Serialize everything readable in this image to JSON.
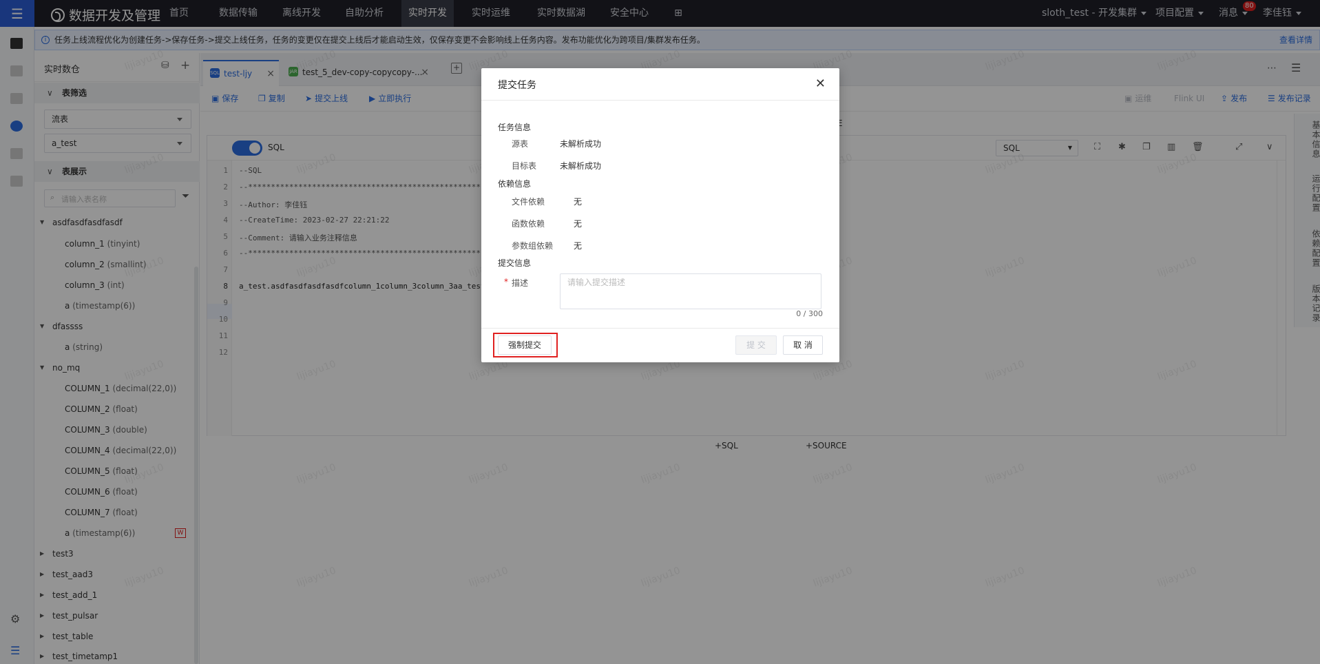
{
  "topnav": {
    "app_title": "数据开发及管理",
    "items": [
      "首页",
      "数据传输",
      "离线开发",
      "自助分析",
      "实时开发",
      "实时运维",
      "实时数据湖",
      "安全中心"
    ],
    "active": "实时开发",
    "cluster": "sloth_test - 开发集群",
    "project_config": "项目配置",
    "messages": "消息",
    "message_count": "80",
    "user": "李佳钰"
  },
  "notice": {
    "text": "任务上线流程优化为创建任务->保存任务->提交上线任务，任务的变更仅在提交上线后才能启动生效，仅保存变更不会影响线上任务内容。发布功能优化为跨项目/集群发布任务。",
    "link": "查看详情"
  },
  "left_panel": {
    "title": "实时数仓",
    "filter_section": "表筛选",
    "stream_select": "流表",
    "db_select": "a_test",
    "display_section": "表展示",
    "search_placeholder": "请输入表名称",
    "tree": [
      {
        "name": "asdfasdfasdfasdf",
        "expanded": true,
        "columns": [
          {
            "name": "column_1",
            "type": "(tinyint)"
          },
          {
            "name": "column_2",
            "type": "(smallint)"
          },
          {
            "name": "column_3",
            "type": "(int)"
          },
          {
            "name": "a",
            "type": "(timestamp(6))"
          }
        ]
      },
      {
        "name": "dfassss",
        "expanded": true,
        "columns": [
          {
            "name": "a",
            "type": "(string)"
          }
        ]
      },
      {
        "name": "no_mq",
        "expanded": true,
        "columns": [
          {
            "name": "COLUMN_1",
            "type": "(decimal(22,0))"
          },
          {
            "name": "COLUMN_2",
            "type": "(float)"
          },
          {
            "name": "COLUMN_3",
            "type": "(double)"
          },
          {
            "name": "COLUMN_4",
            "type": "(decimal(22,0))"
          },
          {
            "name": "COLUMN_5",
            "type": "(float)"
          },
          {
            "name": "COLUMN_6",
            "type": "(float)"
          },
          {
            "name": "COLUMN_7",
            "type": "(float)"
          },
          {
            "name": "a",
            "type": "(timestamp(6))",
            "badge": "W"
          }
        ]
      },
      {
        "name": "test3"
      },
      {
        "name": "test_aad3"
      },
      {
        "name": "test_add_1"
      },
      {
        "name": "test_pulsar"
      },
      {
        "name": "test_table"
      },
      {
        "name": "test_timetamp1"
      }
    ]
  },
  "tabs": [
    {
      "label": "test-ljy",
      "icon": "SQL",
      "active": true
    },
    {
      "label": "test_5_dev-copy-copycopy-...",
      "icon": "JAR",
      "active": false
    }
  ],
  "toolbar": {
    "save": "保存",
    "copy": "复制",
    "submit": "提交上线",
    "run": "立即执行",
    "ops": "运维",
    "flink_ui": "Flink UI",
    "publish": "发布",
    "publish_log": "发布记录"
  },
  "editor": {
    "mode_label": "SQL",
    "lang_select": "SQL",
    "source_hint": "E",
    "lines": [
      "--SQL",
      "--********************************************************************--",
      "--Author: 李佳钰",
      "--CreateTime: 2023-02-27 22:21:22",
      "--Comment: 请输入业务注释信息",
      "--********************************************************************--",
      "",
      "a_test.asdfasdfasdfasdfcolumn_1column_3column_3aa_test",
      "",
      "",
      "",
      ""
    ],
    "add_sql": "+SQL",
    "add_source": "+SOURCE"
  },
  "side_tabs": [
    "基本信息",
    "运行配置",
    "依赖配置",
    "版本记录"
  ],
  "dialog": {
    "title": "提交任务",
    "task_info": "任务信息",
    "source_table_label": "源表",
    "source_table_value": "未解析成功",
    "target_table_label": "目标表",
    "target_table_value": "未解析成功",
    "dep_info": "依赖信息",
    "file_dep_label": "文件依赖",
    "file_dep_value": "无",
    "func_dep_label": "函数依赖",
    "func_dep_value": "无",
    "param_dep_label": "参数组依赖",
    "param_dep_value": "无",
    "submit_info": "提交信息",
    "desc_label": "描述",
    "desc_required": "*",
    "desc_placeholder": "请输入提交描述",
    "counter": "0 / 300",
    "force_submit": "强制提交",
    "submit": "提 交",
    "cancel": "取 消"
  },
  "watermark": "lijiayu10",
  "colors": {
    "accent": "#2b6de0",
    "nav_bg": "#1f2029",
    "highlight": "#e02020"
  }
}
